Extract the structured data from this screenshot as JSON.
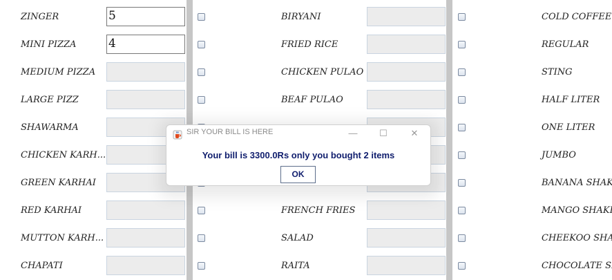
{
  "menu": {
    "food": [
      {
        "label": "ZINGER",
        "qty": "5"
      },
      {
        "label": "MINI PIZZA",
        "qty": "4"
      },
      {
        "label": "MEDIUM PIZZA",
        "qty": ""
      },
      {
        "label": "LARGE PIZZ",
        "qty": ""
      },
      {
        "label": "SHAWARMA",
        "qty": ""
      },
      {
        "label": "CHICKEN KARH...",
        "qty": ""
      },
      {
        "label": "GREEN KARHAI",
        "qty": ""
      },
      {
        "label": "RED KARHAI",
        "qty": ""
      },
      {
        "label": "MUTTON KARH...",
        "qty": ""
      },
      {
        "label": "CHAPATI",
        "qty": ""
      }
    ],
    "rice": [
      {
        "label": "BIRYANI",
        "qty": ""
      },
      {
        "label": "FRIED RICE",
        "qty": ""
      },
      {
        "label": "CHICKEN PULAO",
        "qty": ""
      },
      {
        "label": "BEAF PULAO",
        "qty": ""
      },
      {
        "label": "",
        "qty": ""
      },
      {
        "label": "",
        "qty": ""
      },
      {
        "label": "",
        "qty": ""
      },
      {
        "label": "FRENCH FRIES",
        "qty": ""
      },
      {
        "label": "SALAD",
        "qty": ""
      },
      {
        "label": "RAITA",
        "qty": ""
      }
    ],
    "drinks": [
      {
        "label": "COLD COFFEE"
      },
      {
        "label": "REGULAR"
      },
      {
        "label": "STING"
      },
      {
        "label": "HALF LITER"
      },
      {
        "label": "ONE LITER"
      },
      {
        "label": "JUMBO"
      },
      {
        "label": "BANANA SHAKE"
      },
      {
        "label": "MANGO SHAKE"
      },
      {
        "label": "CHEEKOO SHAKE"
      },
      {
        "label": "CHOCOLATE SHAKE"
      }
    ]
  },
  "dialog": {
    "title": "SIR YOUR BILL IS HERE",
    "message": "Your bill is 3300.0Rs only you bought 2 items",
    "ok_label": "OK",
    "minimize_glyph": "—",
    "maximize_glyph": "☐",
    "close_glyph": "✕",
    "icon": "java-cup-icon"
  },
  "colors": {
    "message_text": "#0f1d6d",
    "separator": "#c6c6c6",
    "field_bg": "#ececec"
  }
}
